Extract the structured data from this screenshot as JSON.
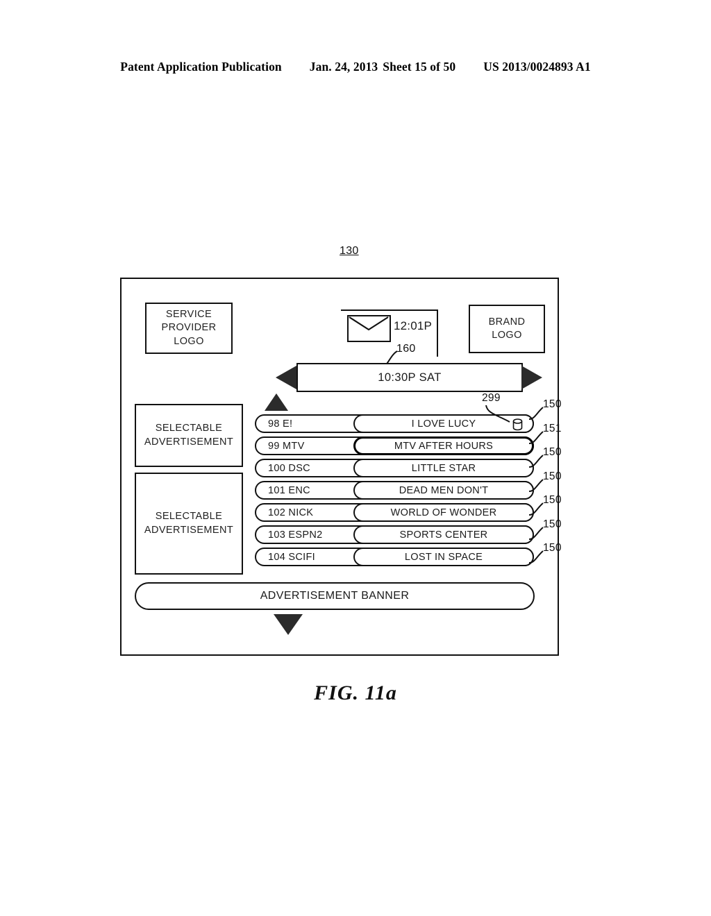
{
  "header": {
    "publication": "Patent Application Publication",
    "date": "Jan. 24, 2013",
    "sheet": "Sheet 15 of 50",
    "patent_number": "US 2013/0024893 A1"
  },
  "figure": {
    "caption": "FIG. 11a",
    "frame_ref": "130"
  },
  "screen": {
    "service_provider_logo": {
      "line1": "SERVICE",
      "line2": "PROVIDER",
      "line3": "LOGO"
    },
    "brand_logo": {
      "line1": "BRAND",
      "line2": "LOGO"
    },
    "status": {
      "mail_icon": "envelope-icon",
      "time": "12:01P",
      "ref": "160"
    },
    "timebar": {
      "value": "10:30P SAT",
      "prev_icon": "triangle-left-icon",
      "next_icon": "triangle-right-icon"
    },
    "advertisements": [
      {
        "line1": "SELECTABLE",
        "line2": "ADVERTISEMENT"
      },
      {
        "line1": "SELECTABLE",
        "line2": "ADVERTISEMENT"
      }
    ],
    "scroll_up_icon": "triangle-up-icon",
    "scroll_down_icon": "triangle-down-icon",
    "cursor_ref": "299",
    "channels": [
      {
        "channel": "98 E!",
        "program": "I LOVE LUCY",
        "ref": "150",
        "selected": false,
        "cursor": true
      },
      {
        "channel": "99 MTV",
        "program": "MTV AFTER HOURS",
        "ref": "151",
        "selected": true,
        "cursor": false
      },
      {
        "channel": "100 DSC",
        "program": "LITTLE STAR",
        "ref": "150",
        "selected": false,
        "cursor": false
      },
      {
        "channel": "101 ENC",
        "program": "DEAD MEN DON'T",
        "ref": "150",
        "selected": false,
        "cursor": false
      },
      {
        "channel": "102 NICK",
        "program": "WORLD OF WONDER",
        "ref": "150",
        "selected": false,
        "cursor": false
      },
      {
        "channel": "103 ESPN2",
        "program": "SPORTS CENTER",
        "ref": "150",
        "selected": false,
        "cursor": false
      },
      {
        "channel": "104 SCIFI",
        "program": "LOST IN SPACE",
        "ref": "150",
        "selected": false,
        "cursor": false
      }
    ],
    "banner": {
      "label": "ADVERTISEMENT BANNER"
    }
  }
}
